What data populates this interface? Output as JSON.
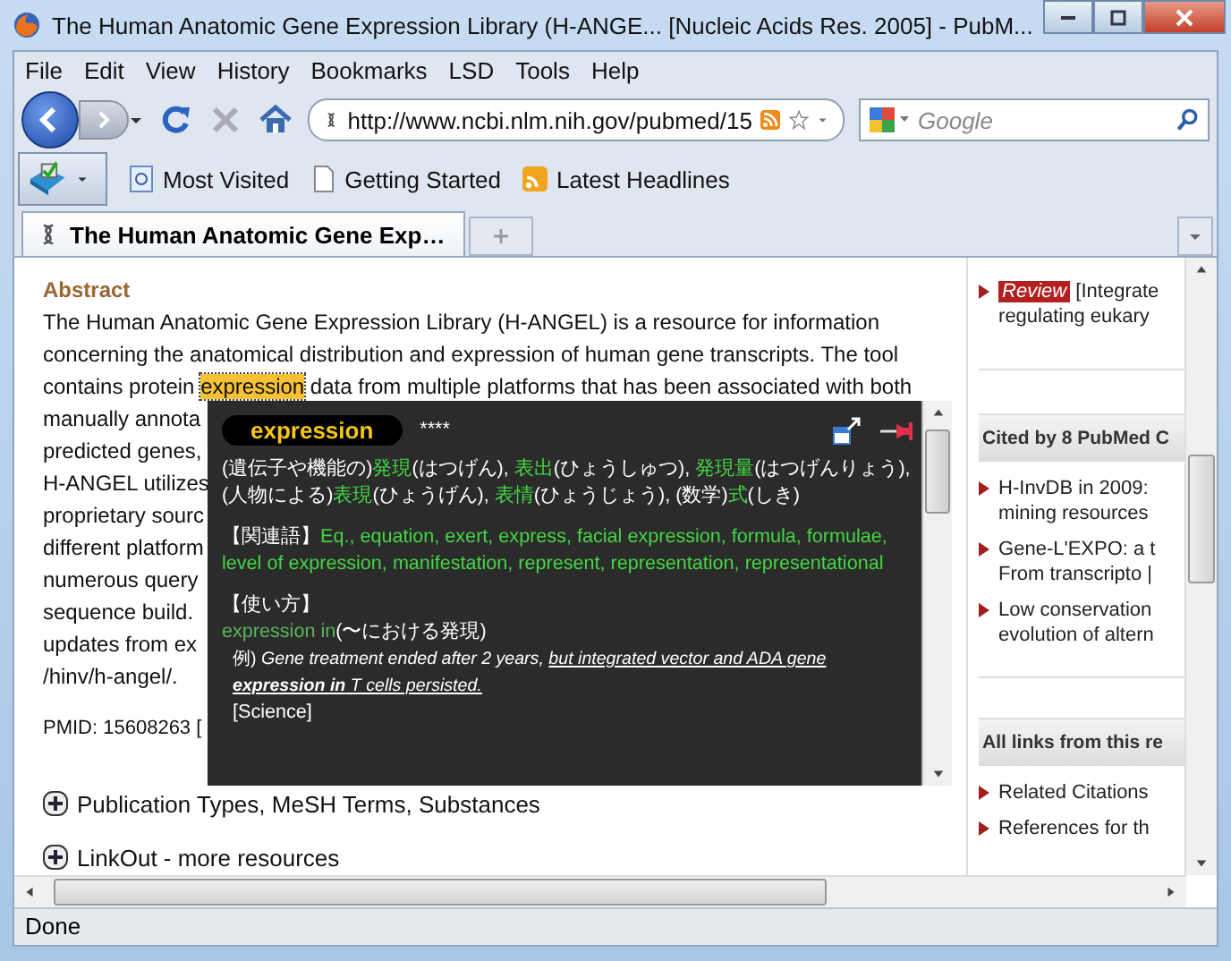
{
  "window": {
    "title": "The Human Anatomic Gene Expression Library (H-ANGE... [Nucleic Acids Res. 2005] - PubM..."
  },
  "menu": [
    "File",
    "Edit",
    "View",
    "History",
    "Bookmarks",
    "LSD",
    "Tools",
    "Help"
  ],
  "toolbar": {
    "url": "http://www.ncbi.nlm.nih.gov/pubmed/15",
    "search": {
      "placeholder": "Google"
    }
  },
  "bookmarks": [
    "Most Visited",
    "Getting Started",
    "Latest Headlines"
  ],
  "tabs": [
    {
      "label": "The Human Anatomic Gene Exp…",
      "selected": true
    }
  ],
  "abstract": {
    "heading": "Abstract",
    "lines": [
      {
        "text": "The Human Anatomic Gene Expression Library (H-ANGEL) is a resource for information"
      },
      {
        "text": "concerning the anatomical distribution and expression of human gene transcripts. The tool"
      },
      {
        "before": "contains protein ",
        "highlight": "expression",
        "after": " data from multiple platforms that has been associated with both"
      },
      {
        "text": "manually annota"
      },
      {
        "text": "predicted genes,"
      },
      {
        "text": "H-ANGEL utilizes"
      },
      {
        "text": "proprietary sourc"
      },
      {
        "text": "different platform"
      },
      {
        "text": "numerous query"
      },
      {
        "text": "sequence build."
      },
      {
        "text": "updates from ex"
      },
      {
        "text": "/hinv/h-angel/."
      }
    ],
    "pmid": "PMID: 15608263 [",
    "sections": [
      "Publication Types, MeSH Terms, Substances",
      "LinkOut - more resources"
    ]
  },
  "popup": {
    "word": "expression",
    "stars_text": "****",
    "meaning": [
      {
        "text": "(遺伝子や機能の)",
        "kind": "plain"
      },
      {
        "text": "発現",
        "kind": "term"
      },
      {
        "text": "(はつげん), ",
        "kind": "plain"
      },
      {
        "text": "表出",
        "kind": "term"
      },
      {
        "text": "(ひょうしゅつ), ",
        "kind": "plain"
      },
      {
        "text": "発現量",
        "kind": "term"
      },
      {
        "text": "(はつげんりょう), (人物による)",
        "kind": "plain"
      },
      {
        "text": "表現",
        "kind": "term"
      },
      {
        "text": "(ひょうげん), ",
        "kind": "plain"
      },
      {
        "text": "表情",
        "kind": "term"
      },
      {
        "text": "(ひょうじょう), (数学)",
        "kind": "plain"
      },
      {
        "text": "式",
        "kind": "term"
      },
      {
        "text": "(しき)",
        "kind": "plain"
      }
    ],
    "related_label": "【関連語】",
    "related": [
      "Eq.,",
      "equation,",
      "exert,",
      "express,",
      "facial expression,",
      "formula,",
      "formulae,",
      "level of expression,",
      "manifestation,",
      "represent,",
      "representation,",
      "representational"
    ],
    "usage_label": "【使い方】",
    "usage_phrase": "expression in",
    "usage_gloss": "(〜における発現)",
    "example_label": "例)",
    "example_plain": "Gene treatment ended after 2 years,",
    "example_underlined": "but integrated vector and ADA gene **expression in** T cells persisted.",
    "source": "[Science]"
  },
  "sidebar": {
    "top_item": {
      "badge": "Review",
      "lines": [
        "[Integrate",
        "regulating eukary"
      ]
    },
    "panels": [
      {
        "title": "Cited by 8 PubMed C",
        "items": [
          {
            "lines": [
              "H-InvDB in 2009:",
              "mining resources"
            ]
          },
          {
            "lines": [
              "Gene-L'EXPO: a t",
              "From transcripto |"
            ]
          },
          {
            "lines": [
              "Low conservation",
              "evolution of altern"
            ]
          }
        ]
      },
      {
        "title": "All links from this re",
        "items": [
          {
            "lines": [
              "Related Citations"
            ]
          },
          {
            "lines": [
              "References for th"
            ]
          }
        ]
      }
    ]
  },
  "status_bar": "Done"
}
